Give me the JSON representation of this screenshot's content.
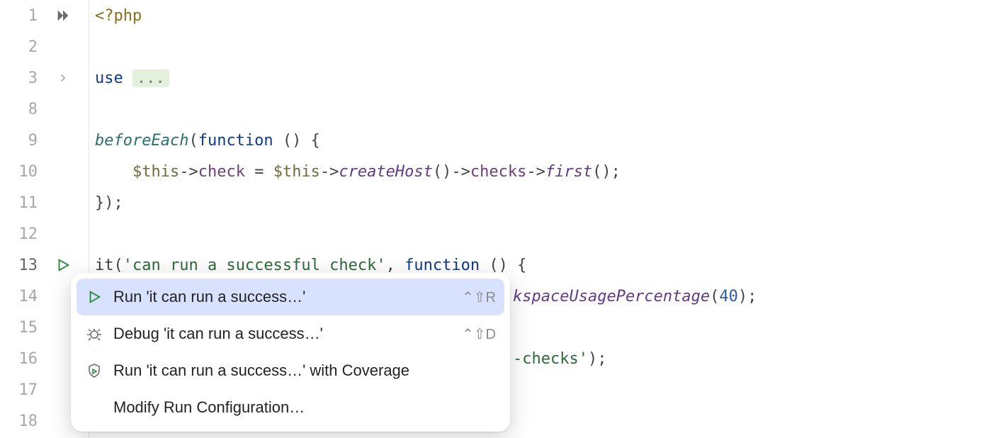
{
  "gutter": {
    "lines": [
      "1",
      "2",
      "3",
      "8",
      "9",
      "10",
      "11",
      "12",
      "13",
      "14",
      "15",
      "16",
      "17",
      "18"
    ],
    "skip_icon_line": "1",
    "fold_icon_line": "3",
    "run_icon_line": "13"
  },
  "code": {
    "l1": {
      "open": "<?php"
    },
    "l3": {
      "kw": "use",
      "ell": "..."
    },
    "l9": {
      "fn": "beforeEach",
      "p1": "(",
      "kw": "function",
      "p2": " () {"
    },
    "l10": {
      "indent": "    ",
      "var": "$this",
      "arrow1": "->",
      "prop1": "check",
      "eq": " = ",
      "var2": "$this",
      "arrow2": "->",
      "call1": "createHost",
      "paren1": "()",
      "arrow3": "->",
      "prop2": "checks",
      "arrow4": "->",
      "call2": "first",
      "paren2": "();"
    },
    "l11": {
      "close": "});"
    },
    "l13": {
      "fnname": "it",
      "p1": "(",
      "strA": "'can run a successful check'",
      "comma": ", ",
      "kw": "function",
      "p2": " () {"
    },
    "l14": {
      "tail_call": "kspaceUsagePercentage",
      "p1": "(",
      "num": "40",
      "p2": ");"
    },
    "l16": {
      "tail_str": "-checks'",
      "p2": ");"
    }
  },
  "menu": {
    "items": [
      {
        "icon": "play",
        "label": "Run 'it can run a success…'",
        "shortcut": "⌃⇧R",
        "selected": true
      },
      {
        "icon": "bug",
        "label": "Debug 'it can run a success…'",
        "shortcut": "⌃⇧D",
        "selected": false
      },
      {
        "icon": "shield-play",
        "label": "Run 'it can run a success…' with Coverage",
        "shortcut": "",
        "selected": false
      },
      {
        "icon": "",
        "label": "Modify Run Configuration…",
        "shortcut": "",
        "selected": false
      }
    ]
  }
}
